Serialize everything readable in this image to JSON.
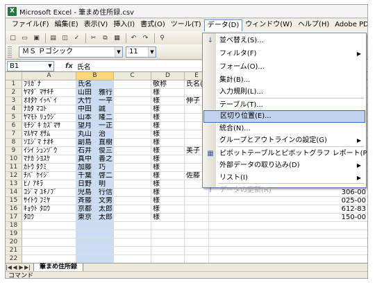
{
  "window": {
    "app_icon": "X",
    "title": "Microsoft Excel - 筆まめ住所録.csv"
  },
  "menubar": {
    "items": [
      "ファイル(F)",
      "編集(E)",
      "表示(V)",
      "挿入(I)",
      "書式(O)",
      "ツール(T)",
      "データ(D)",
      "ウィンドウ(W)",
      "ヘルプ(H)",
      "Adobe PDF(B)"
    ],
    "active": "データ(D)"
  },
  "formatting": {
    "font_name": "ＭＳ Ｐゴシック",
    "font_size": "11"
  },
  "formula_bar": {
    "name_box": "B1",
    "fx": "fx",
    "content": "氏名"
  },
  "columns": [
    "A",
    "B",
    "C",
    "D",
    "E"
  ],
  "selected_column": "B",
  "rows": [
    {
      "num": "1",
      "a": "ﾌﾘｶﾞﾅ",
      "b": "氏名",
      "d": "敬称",
      "e": "氏名("
    },
    {
      "num": "2",
      "a": "ﾔﾏﾀﾞ ﾏｻｷﾁ",
      "b": "山田　雅行",
      "d": "様",
      "e": ""
    },
    {
      "num": "3",
      "a": "ｵｵﾀｹ ｲｯﾍﾟｲ",
      "b": "大竹　一平",
      "d": "様",
      "e": "伸子"
    },
    {
      "num": "4",
      "a": "ﾅｶﾀ ﾏｺﾄ",
      "b": "中田　誠",
      "d": "様",
      "e": ""
    },
    {
      "num": "5",
      "a": "ﾔﾏﾓﾄ ﾘｭｳｼﾞ",
      "b": "山本　隆二",
      "d": "様",
      "e": ""
    },
    {
      "num": "6",
      "a": "ﾓﾁｼﾞｷ ｶｽﾞﾏｻ",
      "b": "望月　一正",
      "d": "様",
      "e": ""
    },
    {
      "num": "7",
      "a": "ﾏﾙﾔﾏ ｵｻﾑ",
      "b": "丸山　治",
      "d": "様",
      "e": ""
    },
    {
      "num": "8",
      "a": "ｿｴｼﾞﾏ ﾅｵｷ",
      "b": "副島　直樹",
      "d": "様",
      "e": ""
    },
    {
      "num": "9",
      "a": "ｲｼｲ ｼｭﾝｿﾞｳ",
      "b": "石井　俊三",
      "d": "様",
      "e": "美子"
    },
    {
      "num": "10",
      "a": "ﾏﾅｶ ｼﾖｽｹ",
      "b": "真中　善之",
      "d": "様",
      "e": ""
    },
    {
      "num": "11",
      "a": "ｶﾄｳ ﾀｸﾐ",
      "b": "加藤　巧",
      "d": "様",
      "e": ""
    },
    {
      "num": "12",
      "a": "ﾁﾊﾞ ｹｲｼﾞ",
      "b": "千葉　啓二",
      "d": "様",
      "e": "佐藤"
    },
    {
      "num": "13",
      "a": "ﾋﾉ ｱｷﾗ",
      "b": "日野　明",
      "d": "様",
      "e": ""
    },
    {
      "num": "14",
      "a": "ｺｼﾞﾏ ﾕｷﾉﾌﾞ",
      "b": "児島　行信",
      "d": "様",
      "e": ""
    },
    {
      "num": "15",
      "a": "ｻｲﾄｳ ﾌﾐﾔ",
      "b": "斉藤　文男",
      "d": "様",
      "e": ""
    },
    {
      "num": "16",
      "a": "ｷｮｳﾄ ﾀﾛｳ",
      "b": "京都　太郎",
      "d": "様",
      "e": ""
    },
    {
      "num": "17",
      "a": "ﾀﾛｳ",
      "b": "東京　太郎",
      "d": "様",
      "e": ""
    },
    {
      "num": "18",
      "a": "",
      "b": "",
      "d": "",
      "e": ""
    },
    {
      "num": "19",
      "a": "",
      "b": "",
      "d": "",
      "e": ""
    },
    {
      "num": "20",
      "a": "",
      "b": "",
      "d": "",
      "e": ""
    },
    {
      "num": "21",
      "a": "",
      "b": "",
      "d": "",
      "e": ""
    },
    {
      "num": "22",
      "a": "",
      "b": "",
      "d": "",
      "e": ""
    }
  ],
  "right_col_values": [
    "印刷",
    "-080",
    "-085",
    "-088",
    "-094",
    "-104",
    "-104",
    "-080",
    "-088",
    "-080",
    "-087",
    "-083",
    "-084",
    "306-00",
    "025-00",
    "612-83",
    "150-00"
  ],
  "data_menu": {
    "items": [
      {
        "label": "並べ替え(S)...",
        "icon": "sort-icon",
        "icon_glyph": "↓",
        "arrow": "",
        "state": "normal"
      },
      {
        "label": "フィルタ(F)",
        "icon": "",
        "icon_glyph": "",
        "arrow": "▶",
        "state": "normal"
      },
      {
        "label": "フォーム(O)...",
        "icon": "",
        "icon_glyph": "",
        "arrow": "",
        "state": "normal"
      },
      {
        "label": "集計(B)...",
        "icon": "",
        "icon_glyph": "",
        "arrow": "",
        "state": "normal"
      },
      {
        "label": "入力規則(L)...",
        "icon": "",
        "icon_glyph": "",
        "arrow": "",
        "state": "normal"
      },
      {
        "label": "テーブル(T)...",
        "icon": "",
        "icon_glyph": "",
        "arrow": "",
        "state": "normal"
      },
      {
        "label": "区切り位置(E)...",
        "icon": "",
        "icon_glyph": "",
        "arrow": "",
        "state": "highlighted"
      },
      {
        "label": "統合(N)...",
        "icon": "",
        "icon_glyph": "",
        "arrow": "",
        "state": "normal"
      },
      {
        "label": "グループとアウトラインの設定(G)",
        "icon": "",
        "icon_glyph": "",
        "arrow": "▶",
        "state": "normal"
      },
      {
        "label": "ピボットテーブルとピボットグラフ レポート(P)...",
        "icon": "pivot-table-icon",
        "icon_glyph": "▦",
        "arrow": "",
        "state": "normal"
      },
      {
        "label": "外部データの取り込み(D)",
        "icon": "",
        "icon_glyph": "",
        "arrow": "▶",
        "state": "normal"
      },
      {
        "label": "リスト(I)",
        "icon": "",
        "icon_glyph": "",
        "arrow": "▶",
        "state": "normal"
      },
      {
        "label": "データの更新(R)",
        "icon": "refresh-icon",
        "icon_glyph": "!",
        "arrow": "",
        "state": "disabled"
      }
    ]
  },
  "sheet_tab": "筆まめ住所録",
  "status": "コマンド",
  "colors": {
    "menu_highlight": "#c1d2ee",
    "selected_column": "#c9dcf2",
    "column_header_selected": "#fbd77a"
  }
}
